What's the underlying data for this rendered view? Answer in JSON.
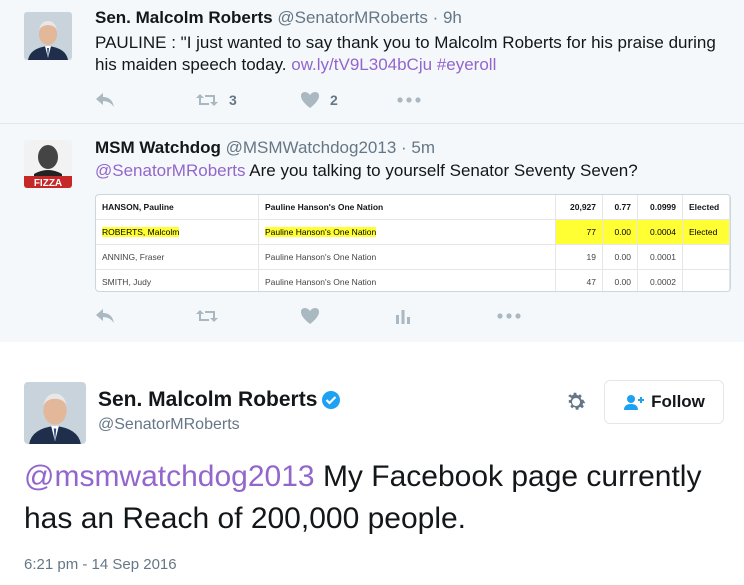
{
  "tweet1": {
    "name": "Sen. Malcolm Roberts",
    "handle": "@SenatorMRoberts",
    "time": "· 9h",
    "text_before": "PAULINE : \"I just wanted to say thank you to Malcolm Roberts for his praise during his maiden speech today. ",
    "link": "ow.ly/tV9L304bCju",
    "hashtag": "#eyeroll",
    "retweets": "3",
    "likes": "2"
  },
  "tweet2": {
    "name": "MSM Watchdog",
    "handle": "@MSMWatchdog2013",
    "time": "· 5m",
    "mention": "@SenatorMRoberts",
    "text": " Are you talking to yourself Senator Seventy Seven?",
    "avatar_text": "FIZZA",
    "table": {
      "rows": [
        {
          "name": "HANSON, Pauline",
          "party": "Pauline Hanson's One Nation",
          "votes": "20,927",
          "quota": "0.77",
          "frac": "0.0999",
          "status": "Elected"
        },
        {
          "name": "ROBERTS, Malcolm",
          "party": "Pauline Hanson's One Nation",
          "votes": "77",
          "quota": "0.00",
          "frac": "0.0004",
          "status": "Elected"
        },
        {
          "name": "ANNING, Fraser",
          "party": "Pauline Hanson's One Nation",
          "votes": "19",
          "quota": "0.00",
          "frac": "0.0001",
          "status": ""
        },
        {
          "name": "SMITH, Judy",
          "party": "Pauline Hanson's One Nation",
          "votes": "47",
          "quota": "0.00",
          "frac": "0.0002",
          "status": ""
        }
      ]
    }
  },
  "main": {
    "name": "Sen. Malcolm Roberts",
    "handle": "@SenatorMRoberts",
    "follow_label": "Follow",
    "mention": "@msmwatchdog2013",
    "text": " My Facebook page currently has an Reach of 200,000 people.",
    "timestamp": "6:21 pm - 14 Sep 2016"
  },
  "colors": {
    "link": "#9266cc",
    "icon": "#aab8c2",
    "verified": "#1da1f2",
    "highlight": "#ffff33"
  }
}
